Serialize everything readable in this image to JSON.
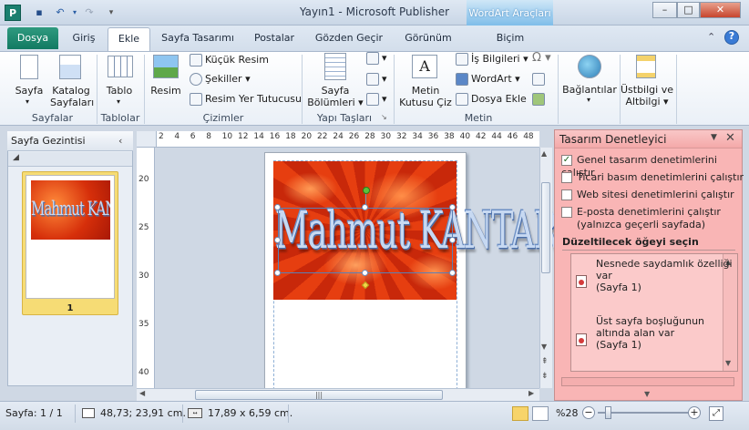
{
  "window": {
    "title": "Yayın1  -  Microsoft Publisher",
    "contextual_group": "WordArt Araçları"
  },
  "qat": {
    "icons": [
      "publisher-app-icon",
      "save-icon",
      "undo-icon",
      "redo-icon",
      "customize-qat-icon"
    ]
  },
  "window_controls": {
    "minimize": "–",
    "maximize": "□",
    "close": "✕"
  },
  "tabs": [
    {
      "label": "Dosya"
    },
    {
      "label": "Giriş"
    },
    {
      "label": "Ekle"
    },
    {
      "label": "Sayfa Tasarımı"
    },
    {
      "label": "Postalar"
    },
    {
      "label": "Gözden Geçir"
    },
    {
      "label": "Görünüm"
    },
    {
      "label": "Biçim"
    }
  ],
  "ribbon": {
    "pages": {
      "sayfa": "Sayfa",
      "katalog_line1": "Katalog",
      "katalog_line2": "Sayfaları",
      "group": "Sayfalar"
    },
    "tables": {
      "tablo": "Tablo",
      "group": "Tablolar"
    },
    "illustrations": {
      "resim": "Resim",
      "kucuk_resim": "Küçük Resim",
      "sekiller": "Şekiller",
      "placeholder": "Resim Yer Tutucusu",
      "group": "Çizimler"
    },
    "building_blocks": {
      "sayfa_line1": "Sayfa",
      "sayfa_line2": "Bölümleri",
      "group": "Yapı Taşları"
    },
    "text": {
      "metin_line1": "Metin",
      "metin_line2": "Kutusu Çiz",
      "is_bilgileri": "İş Bilgileri",
      "wordart": "WordArt",
      "dosya_ekle": "Dosya Ekle",
      "group": "Metin"
    },
    "links": {
      "baglantilar": "Bağlantılar"
    },
    "header_footer": {
      "line1": "Üstbilgi ve",
      "line2": "Altbilgi"
    }
  },
  "nav_pane": {
    "title": "Sayfa Gezintisi",
    "page_number": "1",
    "thumb_text": "Mahmut KANTAR"
  },
  "rulers": {
    "top": [
      "2",
      "4",
      "6",
      "8",
      "10",
      "12",
      "14",
      "16",
      "18",
      "20",
      "22",
      "24",
      "26",
      "28",
      "30",
      "32",
      "34",
      "36",
      "38",
      "40",
      "42",
      "44",
      "46",
      "48"
    ],
    "left": [
      "20",
      "25",
      "30",
      "35",
      "40"
    ]
  },
  "document": {
    "wordart_text": "Mahmut KANTAR"
  },
  "design_checker": {
    "title": "Tasarım Denetleyici",
    "checks": [
      {
        "label": "Genel tasarım denetimlerini çalıştır",
        "checked": true
      },
      {
        "label": "Ticari basım denetimlerini çalıştır",
        "checked": false
      },
      {
        "label": "Web sitesi denetimlerini çalıştır",
        "checked": false
      },
      {
        "label": "E-posta denetimlerini çalıştır",
        "label2": "(yalnızca geçerli sayfada)",
        "checked": false
      }
    ],
    "section_title": "Düzeltilecek öğeyi seçin",
    "issues": [
      {
        "line1": "Nesnede saydamlık özelliği",
        "line2": "var",
        "line3": "(Sayfa 1)"
      },
      {
        "line1": "Üst sayfa boşluğunun",
        "line2": "altında alan var",
        "line3": "(Sayfa 1)"
      }
    ]
  },
  "status": {
    "page": "Sayfa: 1 / 1",
    "position": "48,73; 23,91 cm.",
    "size": "17,89 x  6,59 cm.",
    "zoom": "%28"
  }
}
